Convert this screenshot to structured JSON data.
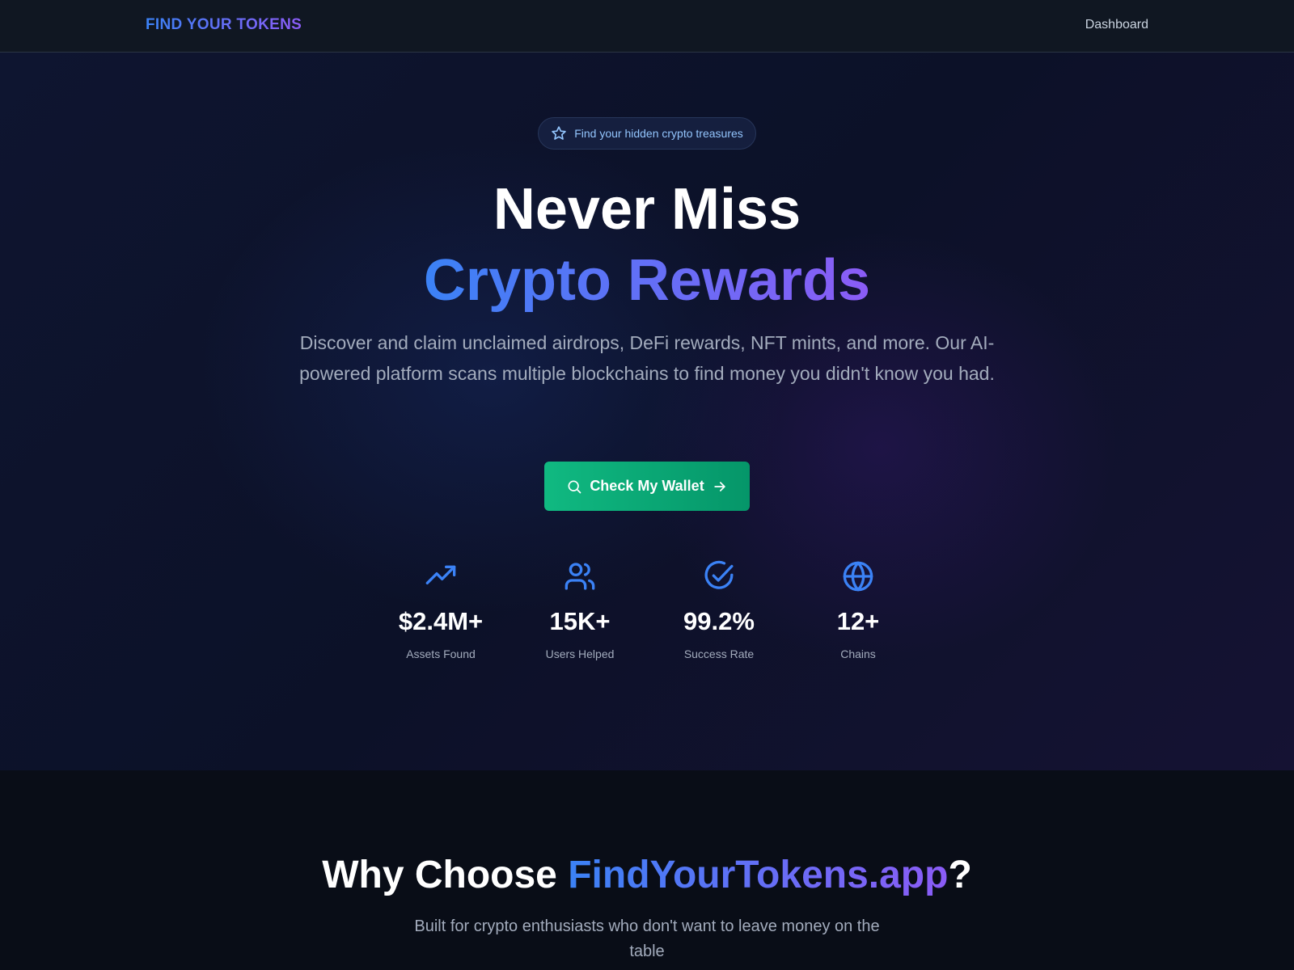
{
  "nav": {
    "brand": "FIND YOUR TOKENS",
    "dashboard_label": "Dashboard"
  },
  "hero": {
    "badge_icon": "star-icon",
    "badge_text": "Find your hidden crypto treasures",
    "headline_line1": "Never Miss",
    "headline_line2": "Crypto Rewards",
    "description": "Discover and claim unclaimed airdrops, DeFi rewards, NFT mints, and more. Our AI-powered platform scans multiple blockchains to find money you didn't know you had.",
    "cta_label": "Check My Wallet",
    "cta_icons": [
      "search-icon",
      "arrow-right-icon"
    ]
  },
  "stats": [
    {
      "icon": "trending-up-icon",
      "value": "$2.4M+",
      "label": "Assets Found"
    },
    {
      "icon": "users-icon",
      "value": "15K+",
      "label": "Users Helped"
    },
    {
      "icon": "check-circle-icon",
      "value": "99.2%",
      "label": "Success Rate"
    },
    {
      "icon": "globe-icon",
      "value": "12+",
      "label": "Chains"
    }
  ],
  "why": {
    "title_prefix": "Why Choose ",
    "title_highlight": "FindYourTokens.app",
    "title_suffix": "?",
    "subtitle": "Built for crypto enthusiasts who don't want to leave money on the table"
  },
  "colors": {
    "accent_blue": "#3b82f6",
    "accent_purple": "#8b5cf6",
    "cta_green": "#10b981"
  }
}
